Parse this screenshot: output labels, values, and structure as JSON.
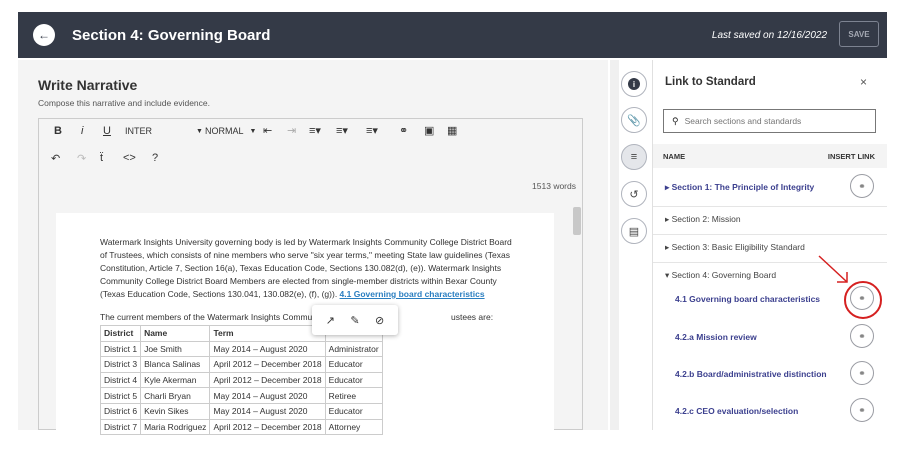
{
  "header": {
    "back_icon": "arrow-left-icon",
    "title": "Section 4: Governing Board",
    "last_saved": "Last saved on 12/16/2022",
    "save_label": "SAVE"
  },
  "editor": {
    "title": "Write Narrative",
    "subtitle": "Compose this narrative and include evidence.",
    "toolbar": {
      "bold": "B",
      "italic": "i",
      "underline": "U",
      "font": "INTER",
      "style": "NORMAL",
      "help": "?"
    },
    "word_count": "1513 words",
    "paragraph_before_link": "Watermark Insights University governing body is led by Watermark Insights Community College District Board of Trustees, which consists of nine members who serve \"six year terms,\" meeting State law guidelines (Texas Constitution, Article 7, Section 16(a), Texas Education Code, Sections 130.082(d), (e)). Watermark Insights Community College District Board Members are elected from single-member districts within Bexar County (Texas Education Code, Sections 130.041, 130.082(e), (f), (g)). ",
    "paragraph_link": "4.1 Governing board characteristics",
    "paragraph2_start": "The current members of the Watermark Insights Community Co",
    "paragraph2_end": "ustees are:",
    "table": {
      "headers": [
        "District",
        "Name",
        "Term",
        ""
      ],
      "rows": [
        [
          "District 1",
          "Joe Smith",
          "May 2014 – August 2020",
          "Administrator"
        ],
        [
          "District 3",
          "Blanca Salinas",
          "April 2012 – December 2018",
          "Educator"
        ],
        [
          "District 4",
          "Kyle Akerman",
          "April 2012 – December 2018",
          "Educator"
        ],
        [
          "District 5",
          "Charli Bryan",
          "May 2014 – August 2020",
          "Retiree"
        ],
        [
          "District 6",
          "Kevin Sikes",
          "May 2014 – August 2020",
          "Educator"
        ],
        [
          "District 7",
          "Maria Rodriguez",
          "April 2012 – December 2018",
          "Attorney"
        ]
      ]
    }
  },
  "panel": {
    "title": "Link to Standard",
    "close": "×",
    "search_placeholder": "Search sections and standards",
    "col_name": "NAME",
    "col_insert": "INSERT LINK",
    "sections": [
      {
        "label": "▸ Section 1: The Principle of Integrity",
        "bold": true,
        "link": true
      },
      {
        "label": "▸ Section 2: Mission",
        "bold": false,
        "link": false
      },
      {
        "label": "▸ Section 3: Basic Eligibility Standard",
        "bold": false,
        "link": false
      },
      {
        "label": "▾ Section 4: Governing Board",
        "bold": false,
        "link": false
      },
      {
        "label": "4.1 Governing board characteristics",
        "bold": true,
        "link": true
      },
      {
        "label": "4.2.a Mission review",
        "bold": true,
        "link": true
      },
      {
        "label": "4.2.b Board/administrative distinction",
        "bold": true,
        "link": true
      },
      {
        "label": "4.2.c CEO evaluation/selection",
        "bold": true,
        "link": true
      }
    ]
  },
  "colors": {
    "header_bg": "#343a47",
    "link_blue": "#2a7ec0",
    "standard_text": "#3b3f8e",
    "highlight_red": "#d52020"
  }
}
